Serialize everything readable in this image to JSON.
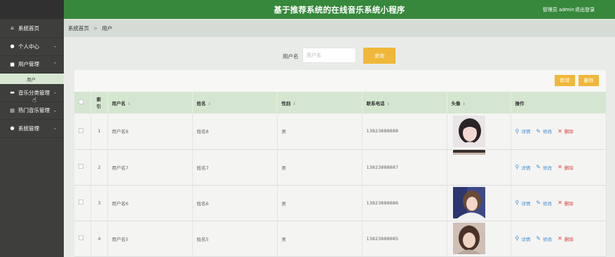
{
  "header": {
    "title": "基于推荐系统的在线音乐系统小程序",
    "admin_label": "管理员 admin",
    "logout_label": "退出登录"
  },
  "sidebar": {
    "items": [
      {
        "label": "系统首页",
        "icon": "home-icon"
      },
      {
        "label": "个人中心",
        "icon": "user-icon"
      },
      {
        "label": "用户管理",
        "icon": "chat-icon"
      },
      {
        "label": "音乐分类管理",
        "icon": "folder-icon"
      },
      {
        "label": "热门音乐管理",
        "icon": "doc-icon"
      },
      {
        "label": "系统管理",
        "icon": "user-icon"
      }
    ],
    "sub_item": "用户"
  },
  "breadcrumb": {
    "home": "系统首页",
    "separator": ">",
    "current": "用户"
  },
  "search": {
    "label": "用户名",
    "placeholder": "用户名",
    "button": "查询"
  },
  "toolbar": {
    "add_label": "新增",
    "delete_label": "删除"
  },
  "table": {
    "index_header": "索引",
    "headers": [
      "用户名",
      "姓名",
      "性别",
      "联系电话",
      "头像",
      "操作"
    ],
    "actions": {
      "detail": "详情",
      "edit": "修改",
      "remove": "删除"
    },
    "rows": [
      {
        "index": "1",
        "username": "用户名8",
        "name": "姓名8",
        "gender": "男",
        "phone": "13823888888"
      },
      {
        "index": "2",
        "username": "用户名7",
        "name": "姓名7",
        "gender": "男",
        "phone": "13823888887"
      },
      {
        "index": "3",
        "username": "用户名6",
        "name": "姓名6",
        "gender": "男",
        "phone": "13823888886"
      },
      {
        "index": "4",
        "username": "用户名5",
        "name": "姓名5",
        "gender": "男",
        "phone": "13823888885"
      }
    ]
  },
  "colors": {
    "header_bg": "#37883c",
    "accent_yellow": "#f0b73a",
    "sidebar_bg": "#3e3f3d"
  }
}
